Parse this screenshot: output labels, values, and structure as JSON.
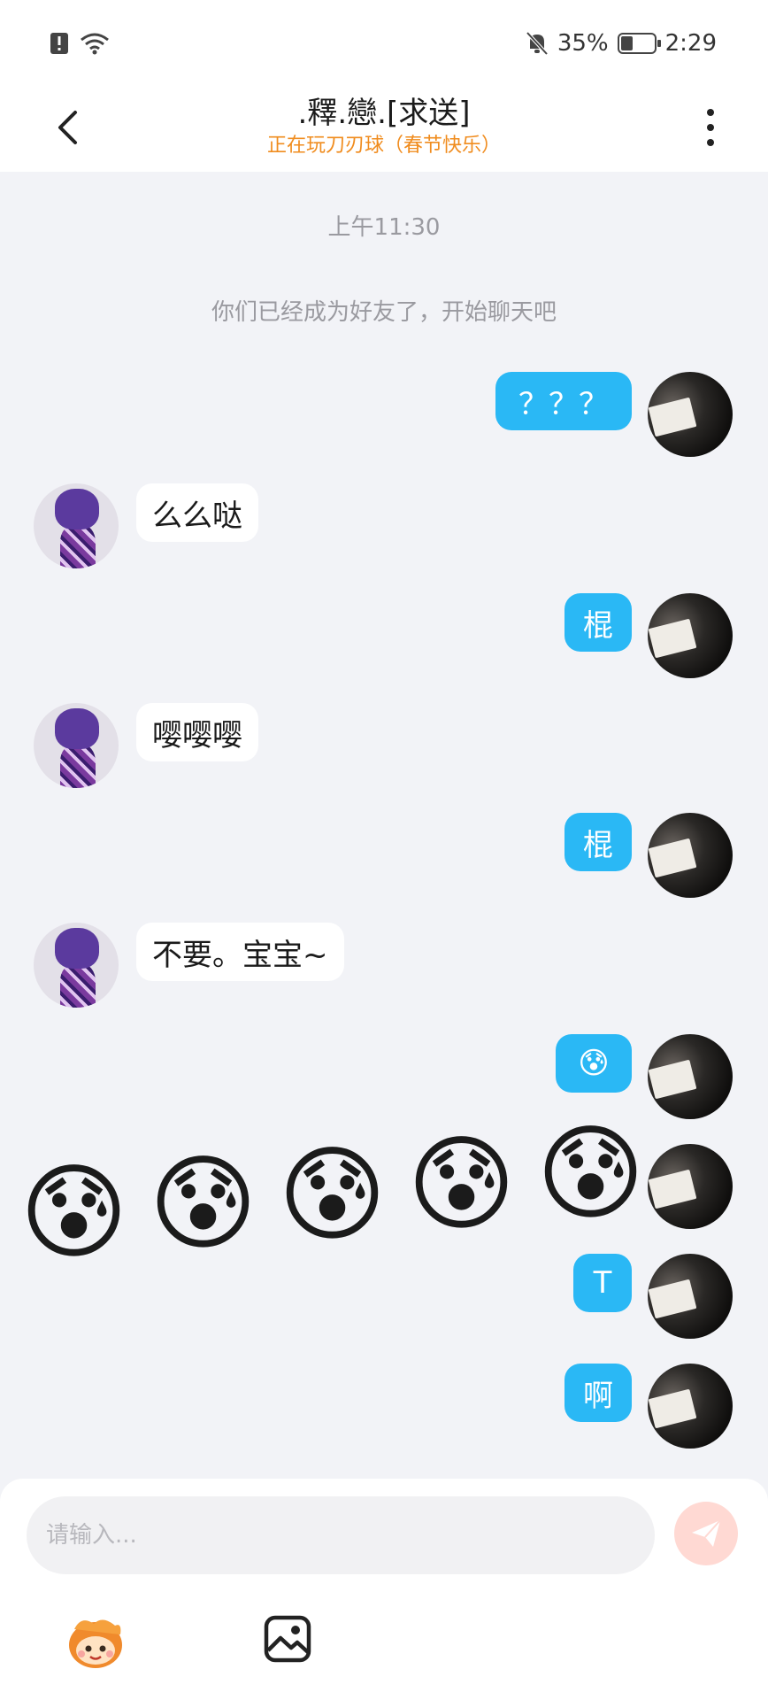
{
  "status_bar": {
    "battery": "35%",
    "battery_level": 0.35,
    "time": "2:29",
    "icons": [
      "alert-icon",
      "wifi-icon",
      "mute-bell-icon",
      "battery-icon"
    ]
  },
  "header": {
    "title": ".釋.戀.[求送]",
    "subtitle": "正在玩刀刃球（春节快乐）",
    "subtitle_color": "#f08c1e"
  },
  "chat": {
    "timestamp": "上午11:30",
    "system_message": "你们已经成为好友了，开始聊天吧",
    "messages": [
      {
        "from": "me",
        "text": "？？？"
      },
      {
        "from": "other",
        "text": "么么哒"
      },
      {
        "from": "me",
        "text": "棍"
      },
      {
        "from": "other",
        "text": "嘤嘤嘤"
      },
      {
        "from": "me",
        "text": "棍"
      },
      {
        "from": "other",
        "text": "不要。宝宝~"
      },
      {
        "from": "me",
        "text": "😰"
      },
      {
        "from": "me",
        "text": "T"
      },
      {
        "from": "me",
        "text": "啊"
      }
    ],
    "emoji_burst": [
      "😰",
      "😰",
      "😰",
      "😰",
      "😰"
    ],
    "bubble_color_me": "#2ab8f5"
  },
  "composer": {
    "placeholder": "请输入...",
    "icons": [
      "send-icon",
      "sticker-icon",
      "image-icon"
    ]
  }
}
